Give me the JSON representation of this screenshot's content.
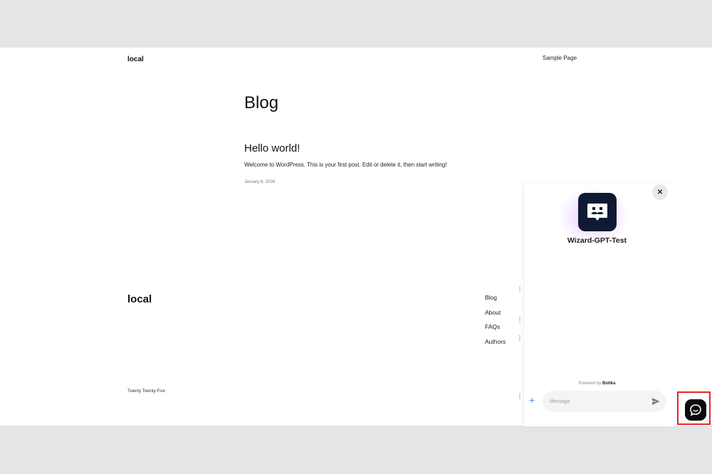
{
  "header": {
    "site_title": "local",
    "nav": [
      "Sample Page"
    ]
  },
  "main": {
    "heading": "Blog",
    "post": {
      "title": "Hello world!",
      "excerpt": "Welcome to WordPress. This is your first post. Edit or delete it, then start writing!",
      "date": "January 8, 2026"
    }
  },
  "footer": {
    "site_title": "local",
    "nav": [
      "Blog",
      "About",
      "FAQs",
      "Authors"
    ],
    "credit": "Twenty Twenty-Five"
  },
  "chat_widget": {
    "bot_name": "Wizard-GPT-Test",
    "powered_by_prefix": "Powered by",
    "powered_by_brand": "Botika",
    "message_placeholder": "Message",
    "close_icon": "close-icon",
    "attach_icon": "plus-icon",
    "send_icon": "send-icon",
    "launcher_icon": "chat-bubble-icon",
    "highlight_color": "#e5262a",
    "avatar_color": "#0e1a33"
  }
}
